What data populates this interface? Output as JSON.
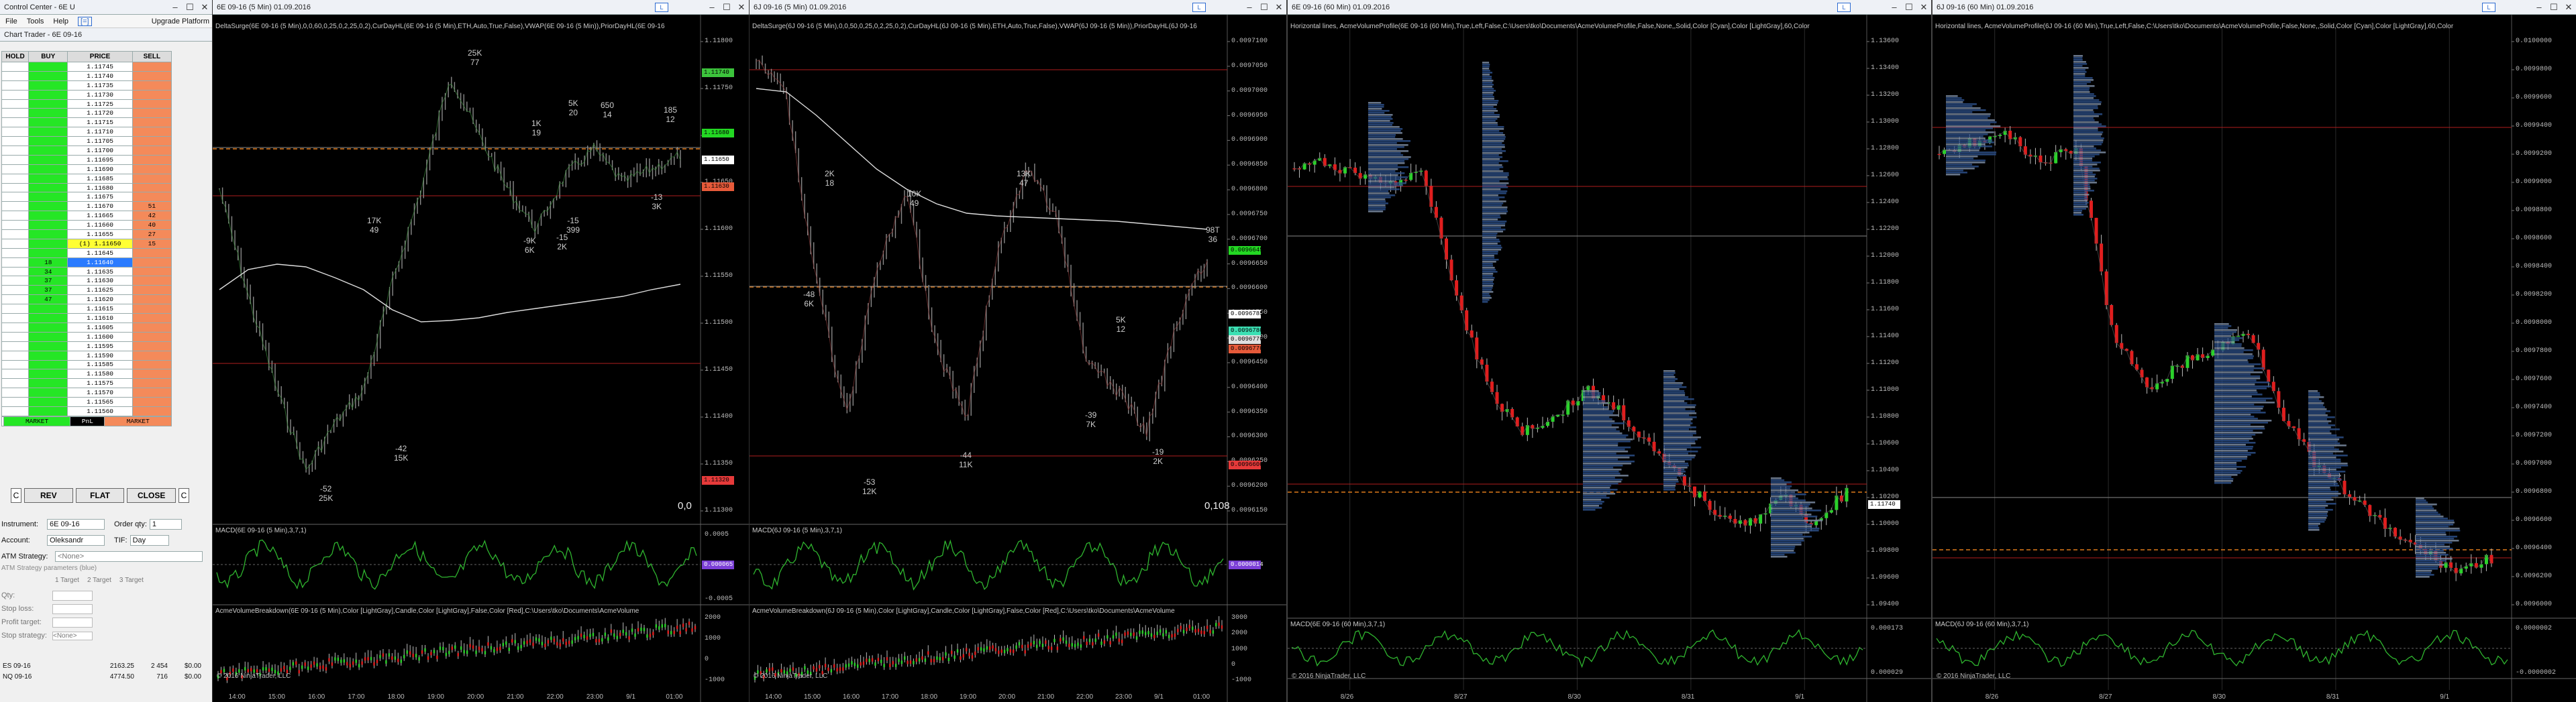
{
  "control_center": {
    "title": "Control Center - 6E U",
    "menu": [
      "File",
      "Tools",
      "Help"
    ],
    "upgrade": "Upgrade Platform",
    "chart_trader_title": "Chart Trader - 6E 09-16",
    "headers": [
      "HOLD",
      "BUY",
      "PRICE",
      "SELL"
    ],
    "prices": [
      "1.11745",
      "1.11740",
      "1.11735",
      "1.11730",
      "1.11725",
      "1.11720",
      "1.11715",
      "1.11710",
      "1.11705",
      "1.11700",
      "1.11695",
      "1.11690",
      "1.11685",
      "1.11680",
      "1.11675",
      "1.11670",
      "1.11665",
      "1.11660",
      "1.11655",
      "1.11650",
      "1.11645",
      "1.11640",
      "1.11635",
      "1.11630",
      "1.11625",
      "1.11620",
      "1.11615",
      "1.11610",
      "1.11605",
      "1.11600",
      "1.11595",
      "1.11590",
      "1.11585",
      "1.11580",
      "1.11575",
      "1.11570",
      "1.11565",
      "1.11560"
    ],
    "sell_sizes": {
      "15": "51",
      "16": "42",
      "17": "40",
      "18": "27",
      "19": "15"
    },
    "buy_sizes": {
      "21": "18",
      "22": "34",
      "23": "37",
      "24": "37",
      "25": "47"
    },
    "position_row": "(1) 1.11650",
    "highlight_price": "1.11640",
    "market_buy": "MARKET",
    "market_sell": "MARKET",
    "pnl": "PnL",
    "buttons": {
      "close_small": "C",
      "rev": "REV",
      "flat": "FLAT",
      "close": "CLOSE"
    },
    "instrument_label": "Instrument:",
    "instrument_value": "6E 09-16",
    "order_qty_label": "Order qty:",
    "order_qty": "1",
    "account_label": "Account:",
    "account_value": "Oleksandr",
    "tif_label": "TIF:",
    "tif_value": "Day",
    "atm_label": "ATM Strategy:",
    "atm_value": "<None>",
    "atm_params": "ATM Strategy parameters (blue)",
    "targets": [
      "1 Target",
      "2 Target",
      "3 Target"
    ],
    "qty_label": "Qty:",
    "stop_loss_label": "Stop loss:",
    "profit_target_label": "Profit target:",
    "stop_strategy_label": "Stop strategy:",
    "stop_strategy_value": "<None>",
    "positions": [
      {
        "inst": "ES 09-16",
        "price": "2163.25",
        "qty": "2 454",
        "val": "$0.00"
      },
      {
        "inst": "NQ 09-16",
        "price": "4774.50",
        "qty": "716",
        "val": "$0.00"
      }
    ]
  },
  "chart1": {
    "title": "6E 09-16 (5 Min)  01.09.2016",
    "header": "DeltaSurge(6E 09-16 (5 Min),0,0,60,0,25,0,2,25,0,2),CurDayHL(6E 09-16 (5 Min),ETH,Auto,True,False),VWAP(6E 09-16 (5 Min)),PriorDayHL(6E 09-16",
    "price_axis": [
      "1.11800",
      "1.11750",
      "1.11700",
      "1.11650",
      "1.11600",
      "1.11550",
      "1.11500",
      "1.11450",
      "1.11400",
      "1.11350",
      "1.11300"
    ],
    "tags": [
      {
        "t": "1.11740",
        "c": "#3cc43c"
      },
      {
        "t": "1.11680",
        "c": "#23d823"
      },
      {
        "t": "1.11650",
        "c": "#ffffff"
      },
      {
        "t": "1.11630",
        "c": "#e65a3a"
      },
      {
        "t": "1.11320",
        "c": "#e63a3a"
      }
    ],
    "labels": [
      {
        "a": "25K",
        "b": "77"
      },
      {
        "a": "17K",
        "b": "49"
      },
      {
        "a": "1K",
        "b": "19"
      },
      {
        "a": "5K",
        "b": "20"
      },
      {
        "a": "650",
        "b": "14"
      },
      {
        "a": "185",
        "b": "12"
      },
      {
        "a": "-9K",
        "b": "6K"
      },
      {
        "a": "-15",
        "b": "399"
      },
      {
        "a": "-15",
        "b": "2K"
      },
      {
        "a": "-13",
        "b": "3K"
      },
      {
        "a": "-42",
        "b": "15K"
      },
      {
        "a": "-52",
        "b": "25K"
      }
    ],
    "corner_value": "0,0",
    "macd_label": "MACD(6E 09-16 (5 Min),3,7,1)",
    "macd_axis": [
      "0.0005",
      "0.0000",
      "-0.0005"
    ],
    "macd_tag": "0.000065",
    "avb_label": "AcmeVolumeBreakdown(6E 09-16 (5 Min),Color [LightGray],Candle,Color [LightGray],False,Color [Red],C:\\Users\\tko\\Documents\\AcmeVolume",
    "avb_axis": [
      "2000",
      "1000",
      "0",
      "-1000"
    ],
    "copyright": "© 2016 NinjaTrader, LLC",
    "x_axis": [
      "14:00",
      "15:00",
      "16:00",
      "17:00",
      "18:00",
      "19:00",
      "20:00",
      "21:00",
      "22:00",
      "23:00",
      "9/1",
      "01:00"
    ]
  },
  "chart2": {
    "title": "6J 09-16 (5 Min)  01.09.2016",
    "header": "DeltaSurge(6J 09-16 (5 Min),0,0,50,0,25,0,2,25,0,2),CurDayHL(6J 09-16 (5 Min),ETH,Auto,True,False),VWAP(6J 09-16 (5 Min)),PriorDayHL(6J 09-16",
    "price_axis": [
      "0.0097100",
      "0.0097050",
      "0.0097000",
      "0.0096950",
      "0.0096900",
      "0.0096850",
      "0.0096800",
      "0.0096750",
      "0.0096700",
      "0.0096650",
      "0.0096600",
      "0.0096550",
      "0.0096500",
      "0.0096450",
      "0.0096400",
      "0.0096350",
      "0.0096300",
      "0.0096250",
      "0.0096200",
      "0.0096150"
    ],
    "tags": [
      {
        "t": "0.0096645",
        "c": "#23d823"
      },
      {
        "t": "0.0096785",
        "c": "#ffffff"
      },
      {
        "t": "0.0096780",
        "c": "#3ce0b4"
      },
      {
        "t": "0.0096770",
        "c": "#e0e0e0"
      },
      {
        "t": "0.0096770",
        "c": "#e65a3a"
      },
      {
        "t": "0.0096600",
        "c": "#e63a3a"
      }
    ],
    "labels": [
      {
        "a": "2K",
        "b": "18"
      },
      {
        "a": "10K",
        "b": "49"
      },
      {
        "a": "13K",
        "b": "47"
      },
      {
        "a": "98T",
        "b": "36"
      },
      {
        "a": "-48",
        "b": "6K"
      },
      {
        "a": "5K",
        "b": "12"
      },
      {
        "a": "-39",
        "b": "7K"
      },
      {
        "a": "-19",
        "b": "2K"
      },
      {
        "a": "-44",
        "b": "11K"
      },
      {
        "a": "-53",
        "b": "12K"
      }
    ],
    "corner_value": "0,108",
    "macd_label": "MACD(6J 09-16 (5 Min),3,7,1)",
    "macd_tag": "0.0000014",
    "avb_label": "AcmeVolumeBreakdown(6J 09-16 (5 Min),Color [LightGray],Candle,Color [LightGray],False,Color [Red],C:\\Users\\tko\\Documents\\AcmeVolume",
    "avb_axis": [
      "3000",
      "2000",
      "1000",
      "0",
      "-1000"
    ],
    "copyright": "© 2016 NinjaTrader, LLC",
    "x_axis": [
      "14:00",
      "15:00",
      "16:00",
      "17:00",
      "18:00",
      "19:00",
      "20:00",
      "21:00",
      "22:00",
      "23:00",
      "9/1",
      "01:00"
    ]
  },
  "chart3": {
    "title": "6E 09-16 (60 Min)  01.09.2016",
    "header": "Horizontal lines, AcmeVolumeProfile(6E 09-16 (60 Min),True,Left,False,C:\\Users\\tko\\Documents\\AcmeVolumeProfile,False,None,,Solid,Color [Cyan],Color [LightGray],60,Color",
    "price_axis": [
      "1.13600",
      "1.13400",
      "1.13200",
      "1.13000",
      "1.12800",
      "1.12600",
      "1.12400",
      "1.12200",
      "1.12000",
      "1.11800",
      "1.11600",
      "1.11400",
      "1.11200",
      "1.11000",
      "1.10800",
      "1.10600",
      "1.10400",
      "1.10200",
      "1.10000",
      "1.09800",
      "1.09600",
      "1.09400"
    ],
    "tags": [
      {
        "t": "1.11740",
        "c": "#ffffff"
      }
    ],
    "macd_label": "MACD(6E 09-16 (60 Min),3,7,1)",
    "macd_axis": [
      "0.000173",
      "0.000029"
    ],
    "copyright": "© 2016 NinjaTrader, LLC",
    "x_axis": [
      "8/26",
      "8/27",
      "8/30",
      "8/31",
      "9/1"
    ],
    "first_tick": "05:00"
  },
  "chart4": {
    "title": "6J 09-16 (60 Min)  01.09.2016",
    "header": "Horizontal lines, AcmeVolumeProfile(6J 09-16 (60 Min),True,Left,False,C:\\Users\\tko\\Documents\\AcmeVolumeProfile,False,None,,Solid,Color [Cyan],Color [LightGray],60,Color",
    "price_axis": [
      "0.0100000",
      "0.0099800",
      "0.0099600",
      "0.0099400",
      "0.0099200",
      "0.0099000",
      "0.0098800",
      "0.0098600",
      "0.0098400",
      "0.0098200",
      "0.0098000",
      "0.0097800",
      "0.0097600",
      "0.0097400",
      "0.0097200",
      "0.0097000",
      "0.0096800",
      "0.0096600",
      "0.0096400",
      "0.0096200",
      "0.0096000"
    ],
    "tags": [],
    "macd_label": "MACD(6J 09-16 (60 Min),3,7,1)",
    "macd_axis": [
      "0.0000002",
      "-0.0000002"
    ],
    "copyright": "© 2016 NinjaTrader, LLC",
    "x_axis": [
      "8/26",
      "8/27",
      "8/30",
      "8/31",
      "9/1"
    ]
  }
}
